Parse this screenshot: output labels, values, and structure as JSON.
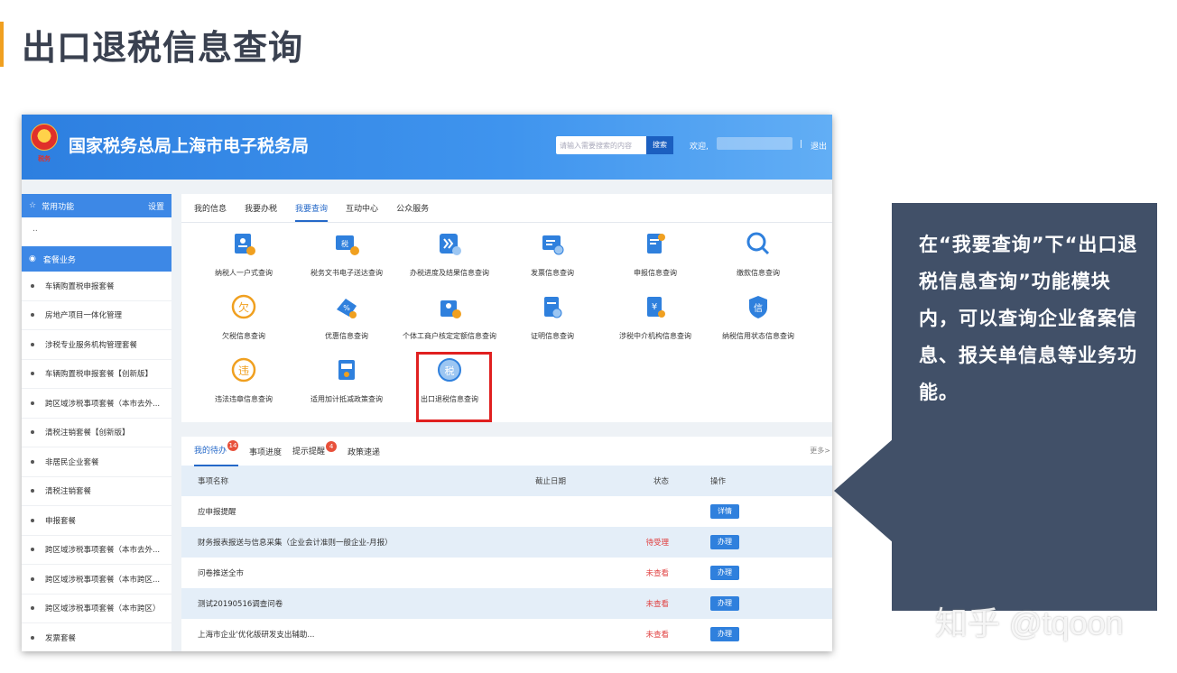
{
  "slide": {
    "title": "出口退税信息查询",
    "accent_color": "#f0a020",
    "callout": {
      "text": "在“我要查询”下“出口退税信息查询”功能模块内，可以查询企业备案信息、报关单信息等业务功能。",
      "bg_color": "#415068"
    },
    "watermark": "知乎 @tqoon"
  },
  "portal": {
    "title": "国家税务总局上海市电子税务局",
    "emblem_text": "税务",
    "search": {
      "placeholder": "请输入需要搜索的内容",
      "button": "搜索"
    },
    "welcome": "欢迎,",
    "separator": "|",
    "logout": "退出",
    "sidebar": {
      "common_label": "常用功能",
      "settings_label": "设置",
      "empty_marker": "..",
      "package_label": "套餐业务",
      "items": [
        "车辆购置税申报套餐",
        "房地产项目一体化管理",
        "涉税专业服务机构管理套餐",
        "车辆购置税申报套餐【创新版】",
        "跨区域涉税事项套餐（本市去外...",
        "清税注销套餐【创新版】",
        "非居民企业套餐",
        "清税注销套餐",
        "申报套餐",
        "跨区域涉税事项套餐（本市去外...",
        "跨区域涉税事项套餐（本市跨区...",
        "跨区域涉税事项套餐（本市跨区）",
        "发票套餐"
      ]
    },
    "tabs": [
      "我的信息",
      "我要办税",
      "我要查询",
      "互动中心",
      "公众服务"
    ],
    "active_tab": "我要查询",
    "tiles": [
      {
        "label": "纳税人一户式查询",
        "icon": "taxpayer-card-icon"
      },
      {
        "label": "税务文书电子送达查询",
        "icon": "tax-document-icon"
      },
      {
        "label": "办税进度及结果信息查询",
        "icon": "progress-icon"
      },
      {
        "label": "发票信息查询",
        "icon": "invoice-icon"
      },
      {
        "label": "申报信息查询",
        "icon": "declaration-icon"
      },
      {
        "label": "缴款信息查询",
        "icon": "payment-search-icon"
      },
      {
        "label": "欠税信息查询",
        "icon": "arrears-icon"
      },
      {
        "label": "优惠信息查询",
        "icon": "discount-icon"
      },
      {
        "label": "个体工商户核定定额信息查询",
        "icon": "individual-business-icon"
      },
      {
        "label": "证明信息查询",
        "icon": "certificate-icon"
      },
      {
        "label": "涉税中介机构信息查询",
        "icon": "intermediary-icon"
      },
      {
        "label": "纳税信用状态信息查询",
        "icon": "credit-icon"
      },
      {
        "label": "违法违章信息查询",
        "icon": "violation-icon"
      },
      {
        "label": "适用加计抵减政策查询",
        "icon": "policy-icon"
      },
      {
        "label": "出口退税信息查询",
        "icon": "export-refund-icon"
      }
    ],
    "tasks": {
      "tabs": [
        {
          "label": "我的待办",
          "badge": "14"
        },
        {
          "label": "事项进度",
          "badge": ""
        },
        {
          "label": "提示提醒",
          "badge": "4"
        },
        {
          "label": "政策速递",
          "badge": ""
        }
      ],
      "more": "更多>",
      "headers": [
        "事项名称",
        "截止日期",
        "状态",
        "操作"
      ],
      "rows": [
        {
          "name": "应申报提醒",
          "deadline": "",
          "status": "",
          "action": "详情"
        },
        {
          "name": "财务报表报送与信息采集（企业会计准则一般企业-月报）",
          "deadline": "",
          "status": "待受理",
          "action": "办理"
        },
        {
          "name": "问卷推送全市",
          "deadline": "",
          "status": "未查看",
          "action": "办理"
        },
        {
          "name": "测试20190516调查问卷",
          "deadline": "",
          "status": "未查看",
          "action": "办理"
        },
        {
          "name": "上海市企业'优化版研发支出辅助...",
          "deadline": "",
          "status": "未查看",
          "action": "办理"
        }
      ]
    }
  }
}
